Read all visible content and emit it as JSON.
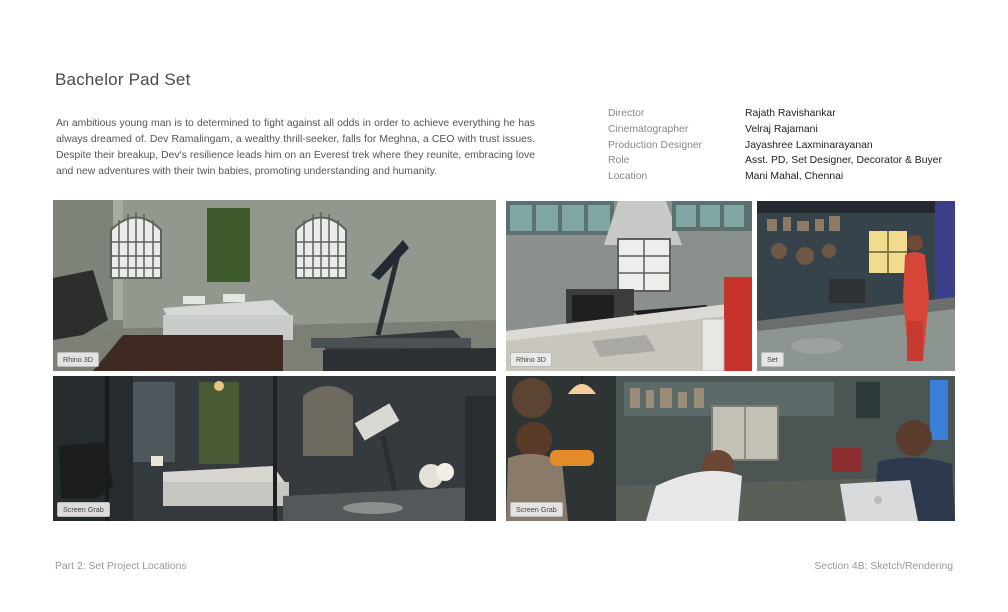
{
  "title": "Bachelor Pad Set",
  "description": "An ambitious young man is to determined to fight against all odds in order to achieve everything he has always dreamed of. Dev Ramalingam, a wealthy thrill-seeker, falls for Meghna, a CEO with trust issues. Despite their breakup, Dev's resilience leads him on an Everest trek where they reunite, embracing love and new adventures with their twin babies, promoting understanding and humanity.",
  "credits": [
    {
      "label": "Director",
      "value": "Rajath Ravishankar"
    },
    {
      "label": "Cinematographer",
      "value": "Velraj Rajamani"
    },
    {
      "label": "Production Designer",
      "value": "Jayashree Laxminarayanan"
    },
    {
      "label": "Role",
      "value": "Asst. PD, Set Designer, Decorator & Buyer"
    },
    {
      "label": "Location",
      "value": "Mani Mahal, Chennai"
    }
  ],
  "photos": [
    {
      "tag": "Rhino 3D"
    },
    {
      "tag": "Rhino 3D"
    },
    {
      "tag": "Set"
    },
    {
      "tag": "Screen Grab"
    },
    {
      "tag": "Screen Grab"
    }
  ],
  "footer": {
    "left": "Part 2: Set Project Locations",
    "right": "Section 4B: Sketch/Rendering"
  }
}
